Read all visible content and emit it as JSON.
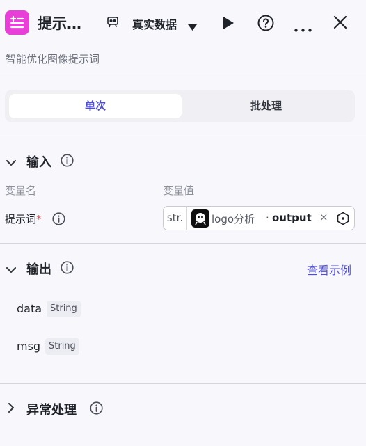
{
  "header": {
    "title": "提示…",
    "env_label": "真实数据",
    "icons": [
      "app-icon",
      "env-icon",
      "caret-down-icon",
      "play-icon",
      "help-icon",
      "more-icon",
      "close-icon"
    ]
  },
  "subtitle": "智能优化图像提示词",
  "tabs": [
    {
      "label": "单次",
      "active": true
    },
    {
      "label": "批处理",
      "active": false
    }
  ],
  "input_section": {
    "title": "输入",
    "col_name": "变量名",
    "col_value": "变量值",
    "field": {
      "label": "提示词",
      "required_mark": "*",
      "type": "str.",
      "ref_node": "logo分析",
      "ref_sep": "·",
      "ref_var": "output",
      "remove": "×"
    }
  },
  "output_section": {
    "title": "输出",
    "example_link": "查看示例",
    "fields": [
      {
        "name": "data",
        "type": "String"
      },
      {
        "name": "msg",
        "type": "String"
      }
    ]
  },
  "exception_section": {
    "title": "异常处理"
  },
  "colors": {
    "accent": "#4e4dd6",
    "app_icon": "#e73fd8",
    "required": "#e5484d",
    "background": "#f8f8fc"
  }
}
